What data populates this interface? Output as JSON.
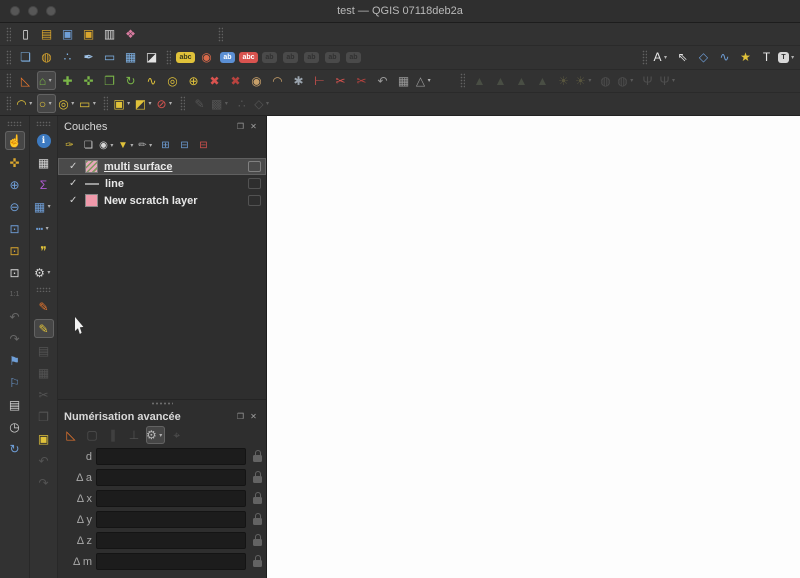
{
  "window": {
    "title": "test — QGIS 07118deb2a"
  },
  "colors": {
    "titlebar": "#2f2f2f",
    "toolbar": "#323232",
    "panel": "#2e2e2e",
    "canvas": "#fdfdfd",
    "selection_row": "#4a4a4a",
    "accent_yellow": "#e0c23a",
    "accent_blue": "#6f9fd8",
    "accent_green": "#7ab648",
    "accent_orange": "#e8762d",
    "accent_red": "#d9534f",
    "layer_pink": "#f09aab"
  },
  "titlebar_buttons": [
    {
      "n": "close-window-button"
    },
    {
      "n": "minimize-window-button"
    },
    {
      "n": "zoom-window-button"
    }
  ],
  "toolbars": {
    "row1": [
      {
        "t": "sep",
        "n": "project-toolbar-handle"
      },
      {
        "n": "new-project-icon",
        "g": "▯",
        "c": "#e9e9e9"
      },
      {
        "n": "open-project-icon",
        "g": "▤",
        "c": "#d9a62e"
      },
      {
        "n": "save-project-icon",
        "g": "▣",
        "c": "#6f9fd8"
      },
      {
        "n": "save-project-as-icon",
        "g": "▣",
        "c": "#d9a62e"
      },
      {
        "n": "layout-manager-icon",
        "g": "▥",
        "c": "#d6d6d6"
      },
      {
        "n": "style-manager-icon",
        "g": "❖",
        "c": "#d97ba0"
      },
      {
        "t": "sep",
        "n": "secondary-toolbar-handle",
        "ml": 76
      }
    ],
    "row2": [
      {
        "t": "sep",
        "n": "datasource-toolbar-handle"
      },
      {
        "n": "data-source-manager-icon",
        "g": "❏",
        "c": "#7fb2e5"
      },
      {
        "n": "new-geopackage-layer-icon",
        "g": "◍",
        "c": "#d9a62e"
      },
      {
        "n": "new-spatialite-layer-icon",
        "g": "∴",
        "c": "#7fb2e5"
      },
      {
        "n": "new-shapefile-layer-icon",
        "g": "✒",
        "c": "#9fc3e8"
      },
      {
        "n": "new-scratch-layer-icon",
        "g": "▭",
        "c": "#7fb2e5"
      },
      {
        "n": "new-virtual-layer-icon",
        "g": "▦",
        "c": "#7fb2e5"
      },
      {
        "n": "new-mesh-layer-icon",
        "g": "◪",
        "c": "#e3e3e3"
      },
      {
        "t": "sep",
        "n": "label-toolbar-handle"
      },
      {
        "n": "layer-labeling-icon",
        "g": "abc",
        "pill": true,
        "bg": "#e0c23a",
        "c": "#3a3a1a"
      },
      {
        "n": "layer-diagram-icon",
        "g": "◉",
        "c": "#d96a4a"
      },
      {
        "n": "pin-labels-icon",
        "g": "ab",
        "pill": true,
        "bg": "#5b8fd4",
        "c": "#ffffff"
      },
      {
        "n": "move-label-icon",
        "g": "abc",
        "pill": true,
        "bg": "#d9534f",
        "c": "#ffffff"
      },
      {
        "n": "pin-unpin-labels-icon",
        "g": "ab",
        "pill": true,
        "bg": "#7d7d7d",
        "c": "#2e2e2e",
        "s": "disabled"
      },
      {
        "n": "show-hide-labels-icon",
        "g": "ab",
        "pill": true,
        "bg": "#7d7d7d",
        "c": "#2e2e2e",
        "s": "disabled"
      },
      {
        "n": "move-rotate-label-icon",
        "g": "ab",
        "pill": true,
        "bg": "#7d7d7d",
        "c": "#2e2e2e",
        "s": "disabled"
      },
      {
        "n": "change-label-icon",
        "g": "ab",
        "pill": true,
        "bg": "#7d7d7d",
        "c": "#2e2e2e",
        "s": "disabled"
      },
      {
        "n": "curved-label-icon",
        "g": "ab",
        "pill": true,
        "bg": "#7d7d7d",
        "c": "#2e2e2e",
        "s": "disabled"
      },
      {
        "t": "spacer"
      },
      {
        "t": "sep",
        "n": "annotations-toolbar-handle"
      },
      {
        "n": "main-annotation-layer-icon",
        "g": "A",
        "c": "#e8e8e8",
        "dd": true
      },
      {
        "n": "select-annotation-icon",
        "g": "⇖",
        "c": "#e8e8e8"
      },
      {
        "n": "create-polygon-annotation-icon",
        "g": "◇",
        "c": "#6f9fd8"
      },
      {
        "n": "create-line-annotation-icon",
        "g": "∿",
        "c": "#6f9fd8"
      },
      {
        "n": "create-marker-annotation-icon",
        "g": "★",
        "c": "#e0c23a"
      },
      {
        "n": "create-text-annotation-icon",
        "g": "T",
        "c": "#e8e8e8"
      },
      {
        "n": "form-annotation-icon",
        "g": "T",
        "pill": true,
        "bg": "#d8d8d8",
        "c": "#333333",
        "dd": true
      }
    ],
    "row3": [
      {
        "t": "sep",
        "n": "digitizing-toolbar-handle"
      },
      {
        "n": "cad-tools-icon",
        "g": "◺",
        "c": "#e8762d"
      },
      {
        "n": "digitize-with-segment-icon",
        "g": "⌂",
        "c": "#7ab648",
        "s": "active",
        "dd": true
      },
      {
        "n": "add-feature-icon",
        "g": "✚",
        "c": "#7ab648"
      },
      {
        "n": "move-feature-icon",
        "g": "✜",
        "c": "#7ab648"
      },
      {
        "n": "copy-move-feature-icon",
        "g": "❐",
        "c": "#7ab648"
      },
      {
        "n": "rotate-feature-icon",
        "g": "↻",
        "c": "#7ab648"
      },
      {
        "n": "simplify-feature-icon",
        "g": "∿",
        "c": "#e0c23a"
      },
      {
        "n": "add-ring-icon",
        "g": "◎",
        "c": "#e0c23a"
      },
      {
        "n": "add-part-icon",
        "g": "⊕",
        "c": "#e0c23a"
      },
      {
        "n": "delete-ring-icon",
        "g": "✖",
        "c": "#d9534f"
      },
      {
        "n": "delete-part-icon",
        "g": "✖",
        "c": "#b8433f"
      },
      {
        "n": "fill-ring-icon",
        "g": "◉",
        "c": "#c8a06a"
      },
      {
        "n": "offset-curve-icon",
        "g": "◠",
        "c": "#c8a06a"
      },
      {
        "n": "vertex-tool-icon",
        "g": "✱",
        "c": "#9aa4ae"
      },
      {
        "n": "trim-extend-icon",
        "g": "⊢",
        "c": "#d9534f"
      },
      {
        "n": "split-features-icon",
        "g": "✂",
        "c": "#d9534f"
      },
      {
        "n": "split-parts-icon",
        "g": "✂",
        "c": "#b8433f"
      },
      {
        "n": "reverse-line-icon",
        "g": "↶",
        "c": "#9a9a9a"
      },
      {
        "n": "layout-grid-icon",
        "g": "▦",
        "c": "#9a9a9a"
      },
      {
        "n": "snapping-options-icon",
        "g": "△",
        "c": "#9a9a9a",
        "dd": true
      },
      {
        "t": "sep",
        "n": "mesh-toolbar-handle",
        "ml": 24
      },
      {
        "n": "mesh-digitizing-icon",
        "g": "▲",
        "c": "#7a8a6a",
        "s": "disabled"
      },
      {
        "n": "mesh-force-by-lines-icon",
        "g": "▲",
        "c": "#7a8a6a",
        "s": "disabled"
      },
      {
        "n": "mesh-reindex-icon",
        "g": "▲",
        "c": "#7a8a6a",
        "s": "disabled"
      },
      {
        "n": "mesh-transform-icon",
        "g": "▲",
        "c": "#7a8a6a",
        "s": "disabled"
      },
      {
        "n": "mesh-shading-icon",
        "g": "☀",
        "c": "#a8a05a",
        "s": "disabled"
      },
      {
        "n": "mesh-shading-options-icon",
        "g": "☀",
        "c": "#a8a05a",
        "s": "disabled",
        "dd": true
      },
      {
        "n": "mesh-selection-icon",
        "g": "◍",
        "c": "#8a8a8a",
        "s": "disabled"
      },
      {
        "n": "mesh-selection-options-icon",
        "g": "◍",
        "c": "#8a8a8a",
        "s": "disabled",
        "dd": true
      },
      {
        "n": "mesh-vertex-icon",
        "g": "Ψ",
        "c": "#8a8a8a",
        "s": "disabled"
      },
      {
        "n": "mesh-vertex-options-icon",
        "g": "Ψ",
        "c": "#8a8a8a",
        "s": "disabled",
        "dd": true
      }
    ],
    "row4": [
      {
        "t": "sep",
        "n": "shape-digitizing-toolbar-handle"
      },
      {
        "n": "circular-string-icon",
        "g": "◠",
        "c": "#e0c23a",
        "dd": true
      },
      {
        "n": "draw-circle-icon",
        "g": "○",
        "c": "#e0c23a",
        "s": "active",
        "dd": true
      },
      {
        "n": "draw-ellipse-icon",
        "g": "◎",
        "c": "#e0c23a",
        "dd": true
      },
      {
        "n": "draw-rectangle-icon",
        "g": "▭",
        "c": "#e0c23a",
        "dd": true
      },
      {
        "t": "sep",
        "n": "selection-toolbar-handle"
      },
      {
        "n": "select-features-icon",
        "g": "▣",
        "c": "#e0c23a",
        "dd": true
      },
      {
        "n": "invert-selection-icon",
        "g": "◩",
        "c": "#e0c23a",
        "dd": true
      },
      {
        "n": "deselect-features-icon",
        "g": "⊘",
        "c": "#d9534f",
        "dd": true
      },
      {
        "t": "sep",
        "n": "editing-extra-toolbar-handle"
      },
      {
        "n": "rotate-symbols-icon",
        "g": "✎",
        "c": "#9a9a9a",
        "s": "disabled"
      },
      {
        "n": "move-selection-icon",
        "g": "▩",
        "c": "#9a9a9a",
        "s": "disabled",
        "dd": true
      },
      {
        "n": "offset-symbols-icon",
        "g": "∴",
        "c": "#9a9a9a",
        "s": "disabled"
      },
      {
        "n": "vertex-editor-icon",
        "g": "◇",
        "c": "#9a9a9a",
        "s": "disabled",
        "dd": true
      }
    ]
  },
  "left_outer": [
    {
      "t": "sep",
      "n": "navigation-toolbar-handle",
      "h": true
    },
    {
      "n": "pan-map-icon",
      "g": "☝",
      "c": "#eaeaea",
      "s": "active"
    },
    {
      "n": "pan-to-selection-icon",
      "g": "✜",
      "c": "#d9a62e"
    },
    {
      "n": "zoom-in-icon",
      "g": "⊕",
      "c": "#6f9fd8"
    },
    {
      "n": "zoom-out-icon",
      "g": "⊖",
      "c": "#6f9fd8"
    },
    {
      "n": "zoom-full-icon",
      "g": "⊡",
      "c": "#6f9fd8"
    },
    {
      "n": "zoom-to-selection-icon",
      "g": "⊡",
      "c": "#d9a62e"
    },
    {
      "n": "zoom-to-layer-icon",
      "g": "⊡",
      "c": "#d6d6d6"
    },
    {
      "n": "zoom-native-icon",
      "g": "1:1",
      "fs": 7,
      "c": "#d6d6d6",
      "s": "disabled"
    },
    {
      "n": "zoom-last-icon",
      "g": "↶",
      "c": "#d6d6d6",
      "s": "disabled"
    },
    {
      "n": "zoom-next-icon",
      "g": "↷",
      "c": "#d6d6d6",
      "s": "disabled"
    },
    {
      "n": "new-bookmark-icon",
      "g": "⚑",
      "c": "#6f9fd8"
    },
    {
      "n": "show-bookmarks-icon",
      "g": "⚐",
      "c": "#6f9fd8"
    },
    {
      "n": "bookmark-manager-icon",
      "g": "▤",
      "c": "#d6d6d6"
    },
    {
      "n": "temporal-controller-icon",
      "g": "◷",
      "c": "#d6d6d6"
    },
    {
      "n": "refresh-map-icon",
      "g": "↻",
      "c": "#6f9fd8"
    }
  ],
  "left_inner": [
    {
      "t": "sep",
      "n": "attributes-toolbar-handle",
      "h": true
    },
    {
      "n": "identify-features-icon",
      "g": "ℹ",
      "c": "#ffffff",
      "bg": "#3d7ac0",
      "round": true
    },
    {
      "n": "open-attribute-table-icon",
      "g": "▦",
      "c": "#d6d6d6"
    },
    {
      "n": "statistical-summary-icon",
      "g": "Σ",
      "c": "#b05bd4"
    },
    {
      "n": "select-by-value-icon",
      "g": "▦",
      "c": "#6f9fd8",
      "dd": true
    },
    {
      "n": "measure-icon",
      "g": "┅",
      "c": "#6f9fd8",
      "dd": true
    },
    {
      "n": "map-tips-icon",
      "g": "❞",
      "c": "#e0c23a"
    },
    {
      "n": "run-feature-action-icon",
      "g": "⚙",
      "c": "#d6d6d6",
      "dd": true
    },
    {
      "t": "sep",
      "n": "digitizing-vertical-handle",
      "h": true
    },
    {
      "n": "current-edits-icon",
      "g": "✎",
      "c": "#e8762d"
    },
    {
      "n": "toggle-editing-icon",
      "g": "✎",
      "c": "#e0c23a",
      "s": "active"
    },
    {
      "n": "save-edits-icon",
      "g": "▤",
      "c": "#9a9a9a",
      "s": "disabled"
    },
    {
      "n": "multiedit-attributes-icon",
      "g": "▦",
      "c": "#9a9a9a",
      "s": "disabled"
    },
    {
      "n": "cut-features-icon",
      "g": "✂",
      "c": "#9a9a9a",
      "s": "disabled"
    },
    {
      "n": "copy-features-icon",
      "g": "❐",
      "c": "#9a9a9a",
      "s": "disabled"
    },
    {
      "n": "paste-features-icon",
      "g": "▣",
      "c": "#e0c23a"
    },
    {
      "n": "undo-icon",
      "g": "↶",
      "c": "#9a9a9a",
      "s": "disabled"
    },
    {
      "n": "redo-icon",
      "g": "↷",
      "c": "#9a9a9a",
      "s": "disabled"
    }
  ],
  "layers_panel": {
    "title": "Couches",
    "header_buttons": [
      {
        "n": "float-layers-panel-icon",
        "g": "❐"
      },
      {
        "n": "close-layers-panel-icon",
        "g": "✕"
      }
    ],
    "toolbar": [
      {
        "n": "open-layer-styling-icon",
        "g": "✑",
        "c": "#e0c23a"
      },
      {
        "n": "add-group-icon",
        "g": "❏",
        "c": "#d6d6d6"
      },
      {
        "n": "manage-map-themes-icon",
        "g": "◉",
        "c": "#d6d6d6",
        "dd": true
      },
      {
        "n": "filter-legend-icon",
        "g": "▼",
        "c": "#e0c23a",
        "dd": true
      },
      {
        "n": "filter-by-expression-icon",
        "g": "✏",
        "c": "#b0b0b0",
        "dd": true
      },
      {
        "n": "expand-all-icon",
        "g": "⊞",
        "c": "#6f9fd8"
      },
      {
        "n": "collapse-all-icon",
        "g": "⊟",
        "c": "#6f9fd8"
      },
      {
        "n": "remove-layer-icon",
        "g": "⊟",
        "c": "#d9534f"
      }
    ],
    "layers": [
      {
        "name": "multi surface",
        "checked": true,
        "symbol": "fill-hatched",
        "selected": true
      },
      {
        "name": "line",
        "checked": true,
        "symbol": "line",
        "selected": false
      },
      {
        "name": "New scratch layer",
        "checked": true,
        "symbol": "fill-pink",
        "selected": false
      }
    ]
  },
  "digitizing_panel": {
    "title": "Numérisation avancée",
    "header_buttons": [
      {
        "n": "float-digitizing-panel-icon",
        "g": "❐"
      },
      {
        "n": "close-digitizing-panel-icon",
        "g": "✕"
      }
    ],
    "toolbar": [
      {
        "n": "enable-advanced-digitizing-icon",
        "g": "◺",
        "c": "#e8762d"
      },
      {
        "n": "construction-mode-icon",
        "g": "▢",
        "c": "#9a9a9a",
        "s": "disabled"
      },
      {
        "n": "parallel-icon",
        "g": "∥",
        "c": "#9a9a9a",
        "s": "disabled"
      },
      {
        "n": "perpendicular-icon",
        "g": "⊥",
        "c": "#9a9a9a",
        "s": "disabled"
      },
      {
        "n": "digitizing-settings-icon",
        "g": "⚙",
        "c": "#b8b8b8",
        "s": "active",
        "dd": true
      },
      {
        "n": "digitizing-floater-icon",
        "g": "⌖",
        "c": "#9a9a9a",
        "s": "disabled"
      }
    ],
    "rows": [
      {
        "prefix": "",
        "label": "d",
        "value": ""
      },
      {
        "prefix": "Δ",
        "label": "a",
        "value": ""
      },
      {
        "prefix": "Δ",
        "label": "x",
        "value": ""
      },
      {
        "prefix": "Δ",
        "label": "y",
        "value": ""
      },
      {
        "prefix": "Δ",
        "label": "z",
        "value": ""
      },
      {
        "prefix": "Δ",
        "label": "m",
        "value": ""
      }
    ]
  }
}
